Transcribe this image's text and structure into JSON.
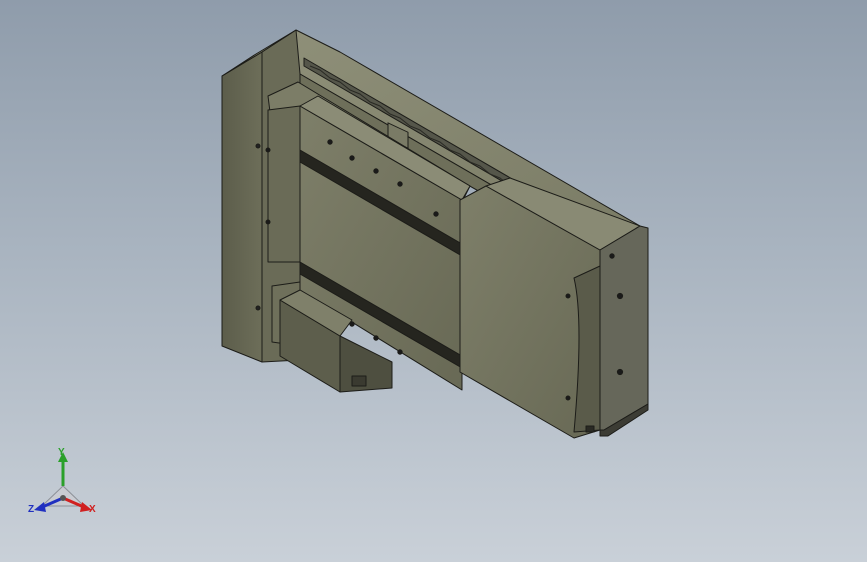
{
  "viewport": {
    "background_top": "#8f9cab",
    "background_bottom": "#c9d0d8",
    "model_color": "#74755f",
    "edge_color": "#1c1c18"
  },
  "triad": {
    "x_label": "X",
    "y_label": "Y",
    "z_label": "Z",
    "x_color": "#d02020",
    "y_color": "#2aa02a",
    "z_color": "#2030c0"
  }
}
